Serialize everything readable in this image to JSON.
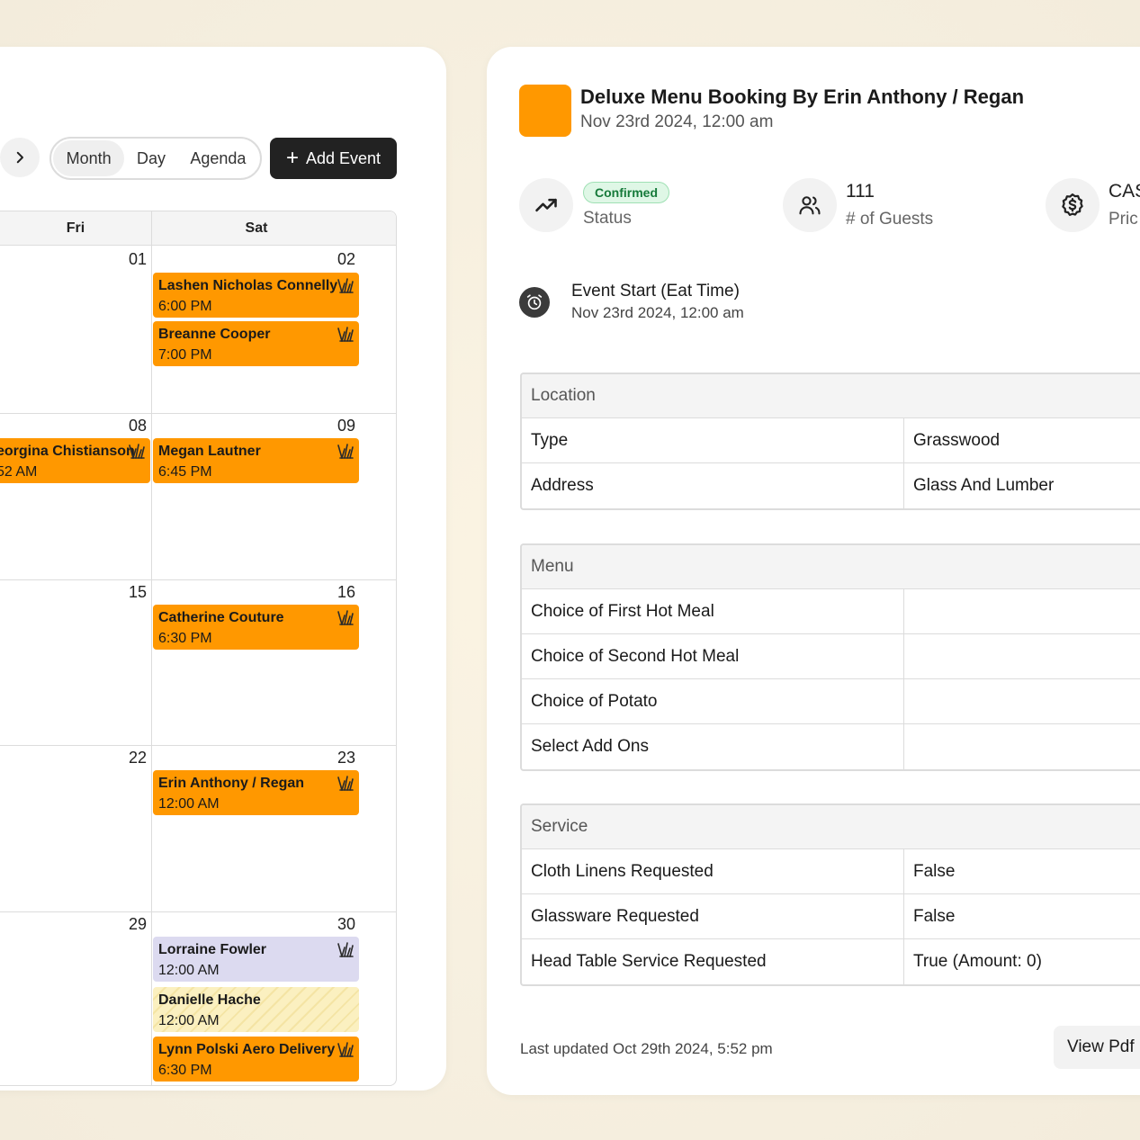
{
  "calendar": {
    "next_icon": "chevron-right-icon",
    "views": [
      "Month",
      "Day",
      "Agenda"
    ],
    "active_view": "Month",
    "add_event_label": "Add Event",
    "days": [
      "Fri",
      "Sat"
    ],
    "dates": {
      "fri": [
        "01",
        "08",
        "15",
        "22",
        "29"
      ],
      "sat": [
        "02",
        "09",
        "16",
        "23",
        "30"
      ]
    },
    "events": {
      "sat_02_a": {
        "name": "Lashen Nicholas Connelly",
        "time": "6:00 PM"
      },
      "sat_02_b": {
        "name": "Breanne Cooper",
        "time": "7:00 PM"
      },
      "fri_08": {
        "name": "eorgina Chistianson",
        "time": "52 AM"
      },
      "sat_09": {
        "name": "Megan Lautner",
        "time": "6:45 PM"
      },
      "sat_16": {
        "name": "Catherine Couture",
        "time": "6:30 PM"
      },
      "sat_23": {
        "name": "Erin Anthony / Regan",
        "time": "12:00 AM"
      },
      "sat_30_a": {
        "name": "Lorraine Fowler",
        "time": "12:00 AM"
      },
      "sat_30_b": {
        "name": "Danielle Hache",
        "time": "12:00 AM"
      },
      "sat_30_c": {
        "name": "Lynn Polski Aero Delivery",
        "time": "6:30 PM"
      }
    },
    "event_icon": "grass-icon",
    "colors": {
      "orange": "#ff9800",
      "lilac": "#dcdaf0",
      "striped": "#fbf0c0"
    }
  },
  "booking": {
    "color": "#ff9800",
    "title": "Deluxe Menu Booking By Erin Anthony / Regan",
    "date": "Nov 23rd 2024, 12:00 am",
    "status": {
      "badge": "Confirmed",
      "label": "Status",
      "icon": "trending-up-icon"
    },
    "guests": {
      "value": "111",
      "label": "# of Guests",
      "icon": "users-icon"
    },
    "price": {
      "value": "CAS",
      "label": "Pric",
      "icon": "dollar-badge-icon"
    },
    "event_start": {
      "title": "Event Start (Eat Time)",
      "date": "Nov 23rd 2024, 12:00 am",
      "icon": "alarm-clock-icon"
    },
    "location": {
      "heading": "Location",
      "rows": [
        {
          "key": "Type",
          "value": "Grasswood"
        },
        {
          "key": "Address",
          "value": "Glass And Lumber"
        }
      ]
    },
    "menu": {
      "heading": "Menu",
      "rows": [
        {
          "key": "Choice of First Hot Meal",
          "value": ""
        },
        {
          "key": "Choice of Second Hot Meal",
          "value": ""
        },
        {
          "key": "Choice of Potato",
          "value": ""
        },
        {
          "key": "Select Add Ons",
          "value": ""
        }
      ]
    },
    "service": {
      "heading": "Service",
      "rows": [
        {
          "key": "Cloth Linens Requested",
          "value": "False"
        },
        {
          "key": "Glassware Requested",
          "value": "False"
        },
        {
          "key": "Head Table Service Requested",
          "value": "True (Amount: 0)"
        }
      ]
    },
    "last_updated": "Last updated Oct 29th 2024, 5:52 pm",
    "view_pdf_label": "View Pdf"
  }
}
